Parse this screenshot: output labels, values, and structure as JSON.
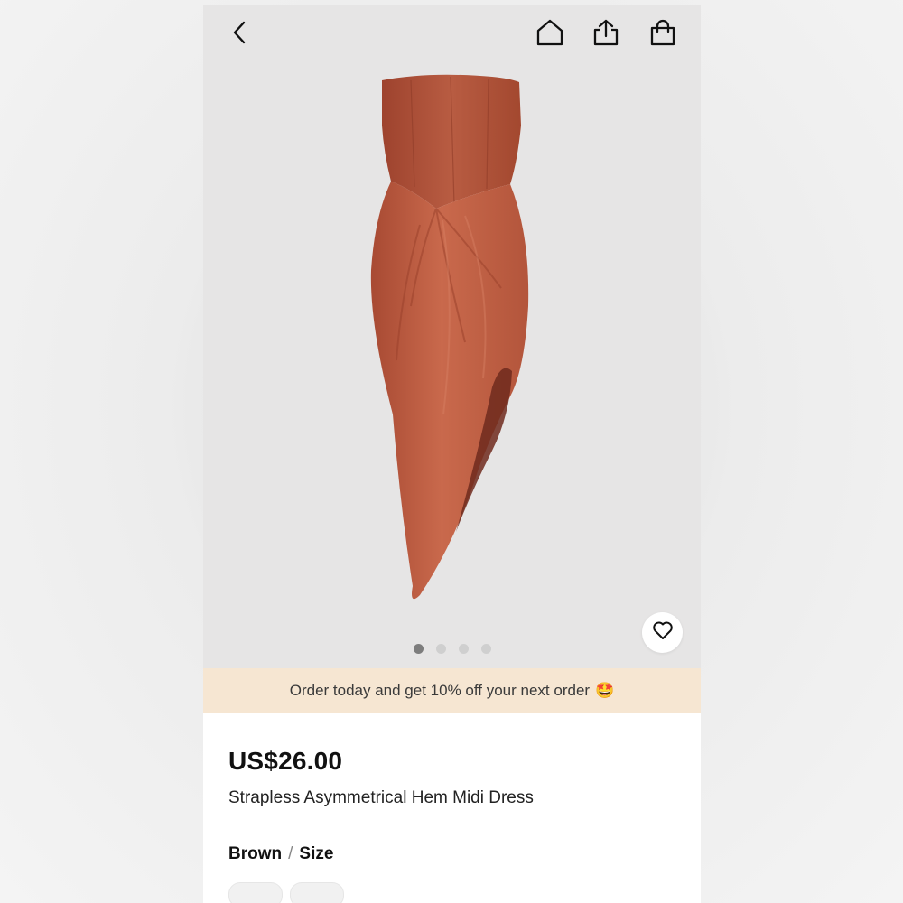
{
  "header": {
    "back_icon": "chevron-left-icon",
    "home_icon": "home-icon",
    "share_icon": "share-icon",
    "bag_icon": "shopping-bag-icon"
  },
  "gallery": {
    "image_alt": "Strapless asymmetrical hem midi dress in rust brown",
    "dots": 4,
    "active_dot": 1,
    "favorite_icon": "heart-outline-icon"
  },
  "promo": {
    "text": "Order today and get 10% off your next order",
    "emoji": "🤩"
  },
  "product": {
    "price": "US$26.00",
    "title": "Strapless Asymmetrical Hem Midi Dress",
    "color_label": "Brown",
    "separator": "/",
    "size_label": "Size"
  },
  "colors": {
    "dress": "#b4543a",
    "promo_bg": "#f6e6d2",
    "gallery_bg": "#e6e5e5"
  }
}
